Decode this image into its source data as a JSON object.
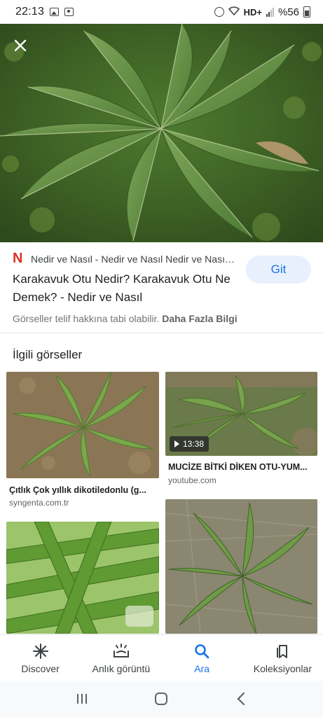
{
  "status_bar": {
    "time": "22:13",
    "network": "HD+",
    "battery": "%56"
  },
  "hero": {
    "close_icon": "close-icon"
  },
  "source": {
    "favicon_letter": "N",
    "site_name": "Nedir ve Nasıl - Nedir ve Nasıl Nedir ve Nasıl ...",
    "title": "Karakavuk Otu Nedir? Karakavuk Otu Ne Demek? - Nedir ve Nasıl",
    "visit_label": "Git",
    "copyright_text": "Görseller telif hakkına tabi olabilir.",
    "more_info": "Daha Fazla Bilgi"
  },
  "related": {
    "heading": "İlgili görseller",
    "items": [
      {
        "title": "",
        "domain": ""
      },
      {
        "duration": "13:38",
        "title": "MUCİZE BİTKİ DİKEN OTU-YUM...",
        "domain": "youtube.com"
      },
      {
        "title": "Çıtlık Çok yıllık dikotiledonlu (g...",
        "domain": "syngenta.com.tr"
      }
    ]
  },
  "bottom_nav": [
    {
      "label": "Discover",
      "icon": "asterisk-icon"
    },
    {
      "label": "Anlık görüntü",
      "icon": "snapshot-icon"
    },
    {
      "label": "Ara",
      "icon": "search-icon"
    },
    {
      "label": "Koleksiyonlar",
      "icon": "bookmarks-icon"
    }
  ],
  "colors": {
    "accent": "#1a73e8",
    "favicon": "#d93025",
    "button_bg": "#e8f0fe"
  }
}
